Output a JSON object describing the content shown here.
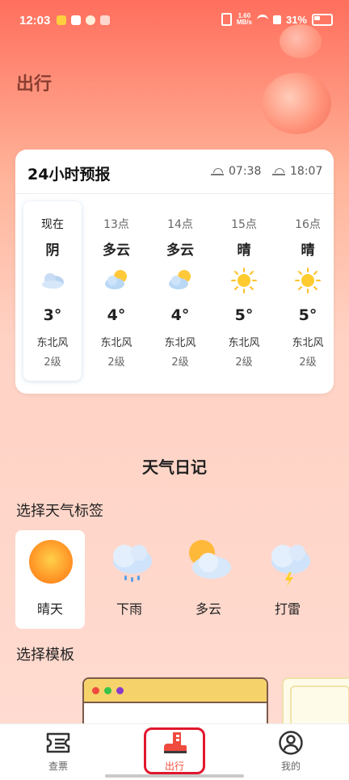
{
  "status_bar": {
    "time": "12:03",
    "net_speed_value": "1.60",
    "net_speed_unit": "MB/s",
    "battery": "31%"
  },
  "page": {
    "title": "出行"
  },
  "forecast": {
    "title": "24小时预报",
    "sunrise": "07:38",
    "sunset": "18:07",
    "hours": [
      {
        "time": "现在",
        "condition": "阴",
        "icon": "overcast-cloud-icon",
        "temp": "3°",
        "wind": "东北风",
        "level": "2级"
      },
      {
        "time": "13点",
        "condition": "多云",
        "icon": "partly-cloudy-icon",
        "temp": "4°",
        "wind": "东北风",
        "level": "2级"
      },
      {
        "time": "14点",
        "condition": "多云",
        "icon": "partly-cloudy-icon",
        "temp": "4°",
        "wind": "东北风",
        "level": "2级"
      },
      {
        "time": "15点",
        "condition": "晴",
        "icon": "sun-icon",
        "temp": "5°",
        "wind": "东北风",
        "level": "2级"
      },
      {
        "time": "16点",
        "condition": "晴",
        "icon": "sun-icon",
        "temp": "5°",
        "wind": "东北风",
        "level": "2级"
      }
    ]
  },
  "diary": {
    "title": "天气日记",
    "select_tag_label": "选择天气标签",
    "tags": [
      {
        "label": "晴天",
        "icon": "sun-icon"
      },
      {
        "label": "下雨",
        "icon": "rain-cloud-icon"
      },
      {
        "label": "多云",
        "icon": "partly-cloudy-icon"
      },
      {
        "label": "打雷",
        "icon": "thunder-cloud-icon"
      }
    ],
    "select_template_label": "选择模板"
  },
  "nav": {
    "items": [
      {
        "label": "查票",
        "icon": "ticket-icon"
      },
      {
        "label": "出行",
        "icon": "boot-icon"
      },
      {
        "label": "我的",
        "icon": "user-icon"
      }
    ]
  },
  "colors": {
    "accent": "#f2503e",
    "highlight_outline": "#e0172d"
  }
}
